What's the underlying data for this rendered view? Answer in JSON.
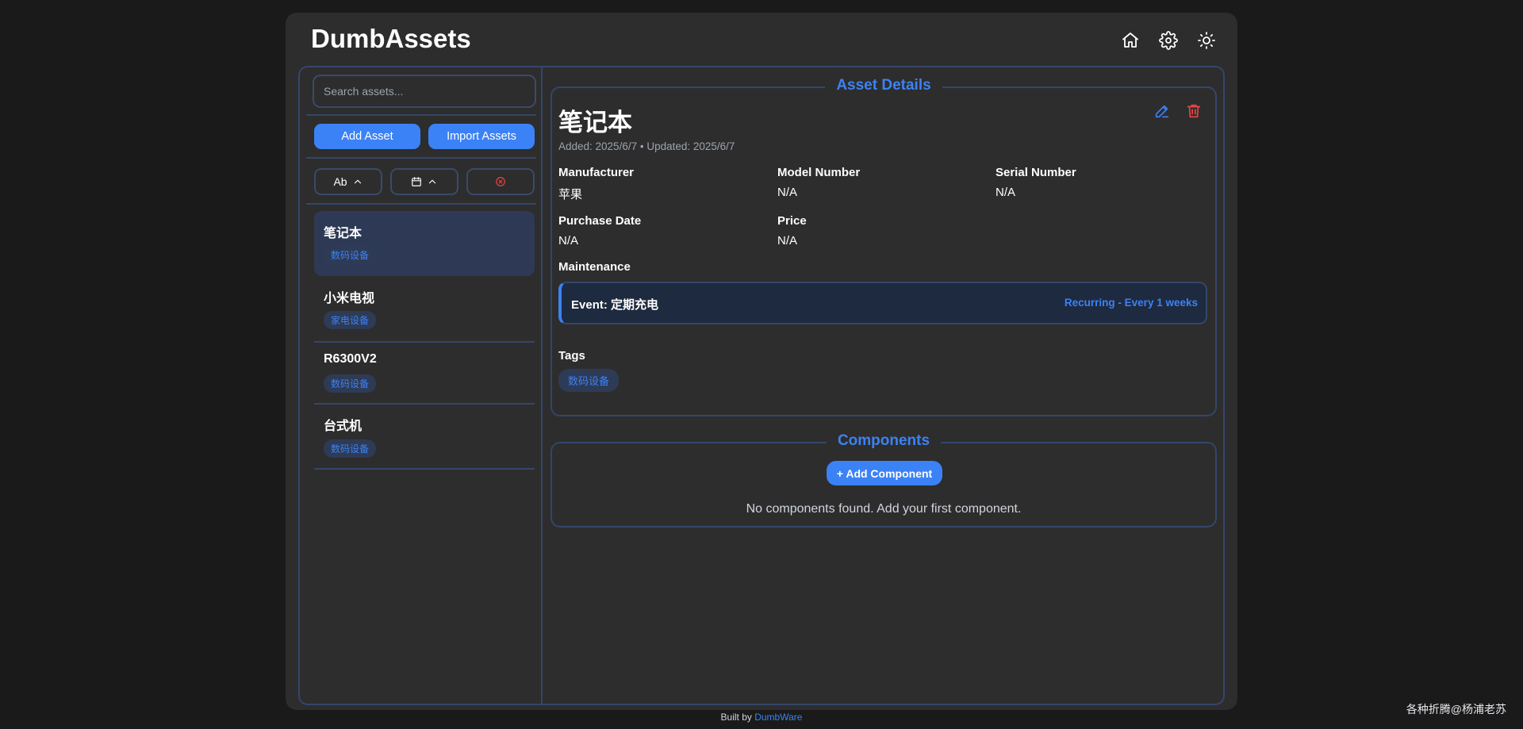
{
  "app": {
    "title": "DumbAssets"
  },
  "header": {
    "icons": [
      "home-icon",
      "settings-icon",
      "sun-icon"
    ]
  },
  "sidebar": {
    "search_placeholder": "Search assets...",
    "add_asset_label": "Add Asset",
    "import_assets_label": "Import Assets",
    "sort_name_label": "Ab",
    "assets": [
      {
        "name": "笔记本",
        "tag": "数码设备",
        "active": true
      },
      {
        "name": "小米电视",
        "tag": "家电设备",
        "active": false
      },
      {
        "name": "R6300V2",
        "tag": "数码设备",
        "active": false
      },
      {
        "name": "台式机",
        "tag": "数码设备",
        "active": false
      }
    ]
  },
  "details": {
    "section_title": "Asset Details",
    "asset_name": "笔记本",
    "meta": "Added: 2025/6/7 • Updated: 2025/6/7",
    "fields": {
      "manufacturer_label": "Manufacturer",
      "manufacturer_value": "苹果",
      "model_label": "Model Number",
      "model_value": "N/A",
      "serial_label": "Serial Number",
      "serial_value": "N/A",
      "purchase_label": "Purchase Date",
      "purchase_value": "N/A",
      "price_label": "Price",
      "price_value": "N/A"
    },
    "maintenance_label": "Maintenance",
    "maintenance_event": "Event: 定期充电",
    "maintenance_recurrence": "Recurring - Every 1 weeks",
    "tags_label": "Tags",
    "tags": [
      "数码设备"
    ]
  },
  "components": {
    "section_title": "Components",
    "add_label": "+ Add Component",
    "empty_text": "No components found. Add your first component."
  },
  "footer": {
    "prefix": "Built by ",
    "link": "DumbWare"
  },
  "watermark": "各种折腾@杨浦老苏",
  "colors": {
    "accent": "#3b82f6",
    "danger": "#ef4444",
    "background": "#1a1a1a",
    "panel": "#2d2d2d",
    "border": "#34466a"
  }
}
